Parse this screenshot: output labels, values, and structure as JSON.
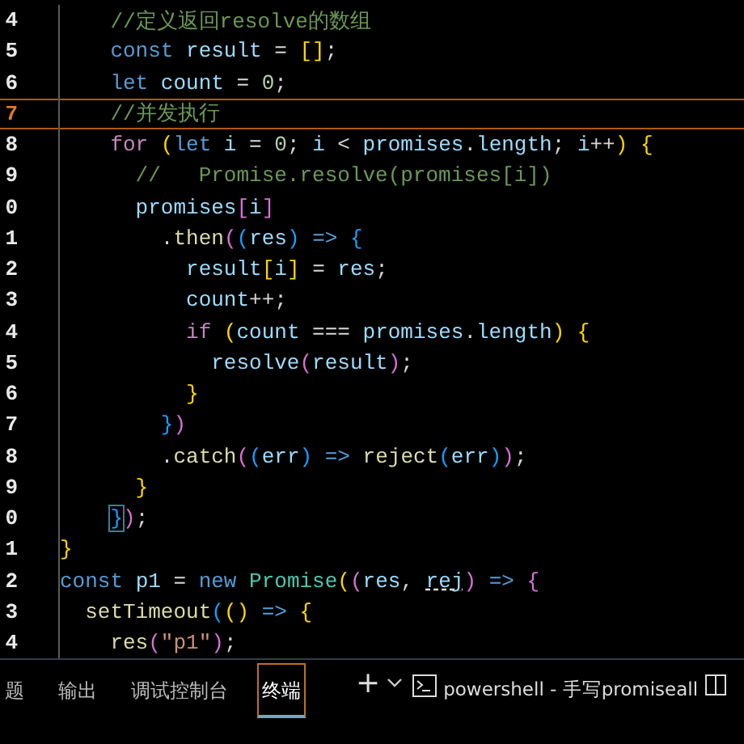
{
  "editor": {
    "lines": [
      {
        "number": "4",
        "current": false,
        "tokens": [
          {
            "t": "    //定义返回resolve的数组",
            "kind": "comment"
          }
        ]
      },
      {
        "number": "5",
        "current": false,
        "tokens": [
          {
            "t": "    const",
            "kind": "kw"
          },
          {
            "t": " result",
            "kind": "var"
          },
          {
            "t": " = ",
            "kind": "plain"
          },
          {
            "t": "[",
            "kind": "br1"
          },
          {
            "t": "]",
            "kind": "br1"
          },
          {
            "t": ";",
            "kind": "plain"
          }
        ]
      },
      {
        "number": "6",
        "current": false,
        "tokens": [
          {
            "t": "    let",
            "kind": "kw"
          },
          {
            "t": " count",
            "kind": "var"
          },
          {
            "t": " = ",
            "kind": "plain"
          },
          {
            "t": "0",
            "kind": "num"
          },
          {
            "t": ";",
            "kind": "plain"
          }
        ]
      },
      {
        "number": "7",
        "current": true,
        "tokens": [
          {
            "t": "    //并发执行",
            "kind": "comment"
          }
        ]
      },
      {
        "number": "8",
        "current": false,
        "tokens": [
          {
            "t": "    for",
            "kind": "ctrl"
          },
          {
            "t": " (",
            "kind": "br1"
          },
          {
            "t": "let",
            "kind": "kw"
          },
          {
            "t": " i",
            "kind": "var"
          },
          {
            "t": " = ",
            "kind": "plain"
          },
          {
            "t": "0",
            "kind": "num"
          },
          {
            "t": "; ",
            "kind": "plain"
          },
          {
            "t": "i",
            "kind": "var"
          },
          {
            "t": " < ",
            "kind": "plain"
          },
          {
            "t": "promises",
            "kind": "var"
          },
          {
            "t": ".",
            "kind": "plain"
          },
          {
            "t": "length",
            "kind": "var"
          },
          {
            "t": "; ",
            "kind": "plain"
          },
          {
            "t": "i",
            "kind": "var"
          },
          {
            "t": "++",
            "kind": "plain"
          },
          {
            "t": ")",
            "kind": "br1"
          },
          {
            "t": " {",
            "kind": "br1"
          }
        ]
      },
      {
        "number": "9",
        "current": false,
        "tokens": [
          {
            "t": "      //   Promise.resolve(promises[i])",
            "kind": "comment"
          }
        ]
      },
      {
        "number": "0",
        "current": false,
        "tokens": [
          {
            "t": "      promises",
            "kind": "var"
          },
          {
            "t": "[",
            "kind": "br2"
          },
          {
            "t": "i",
            "kind": "var"
          },
          {
            "t": "]",
            "kind": "br2"
          }
        ]
      },
      {
        "number": "1",
        "current": false,
        "tokens": [
          {
            "t": "        .",
            "kind": "plain"
          },
          {
            "t": "then",
            "kind": "fn"
          },
          {
            "t": "(",
            "kind": "br2"
          },
          {
            "t": "(",
            "kind": "br3"
          },
          {
            "t": "res",
            "kind": "var"
          },
          {
            "t": ")",
            "kind": "br3"
          },
          {
            "t": " =>",
            "kind": "kw"
          },
          {
            "t": " {",
            "kind": "br3"
          }
        ]
      },
      {
        "number": "2",
        "current": false,
        "tokens": [
          {
            "t": "          result",
            "kind": "var"
          },
          {
            "t": "[",
            "kind": "br1"
          },
          {
            "t": "i",
            "kind": "var"
          },
          {
            "t": "]",
            "kind": "br1"
          },
          {
            "t": " = ",
            "kind": "plain"
          },
          {
            "t": "res",
            "kind": "var"
          },
          {
            "t": ";",
            "kind": "plain"
          }
        ]
      },
      {
        "number": "3",
        "current": false,
        "tokens": [
          {
            "t": "          count",
            "kind": "var"
          },
          {
            "t": "++;",
            "kind": "plain"
          }
        ]
      },
      {
        "number": "4",
        "current": false,
        "tokens": [
          {
            "t": "          if",
            "kind": "ctrl"
          },
          {
            "t": " (",
            "kind": "br1"
          },
          {
            "t": "count",
            "kind": "var"
          },
          {
            "t": " === ",
            "kind": "plain"
          },
          {
            "t": "promises",
            "kind": "var"
          },
          {
            "t": ".",
            "kind": "plain"
          },
          {
            "t": "length",
            "kind": "var"
          },
          {
            "t": ")",
            "kind": "br1"
          },
          {
            "t": " {",
            "kind": "br1"
          }
        ]
      },
      {
        "number": "5",
        "current": false,
        "tokens": [
          {
            "t": "            resolve",
            "kind": "var"
          },
          {
            "t": "(",
            "kind": "br2"
          },
          {
            "t": "result",
            "kind": "var"
          },
          {
            "t": ")",
            "kind": "br2"
          },
          {
            "t": ";",
            "kind": "plain"
          }
        ]
      },
      {
        "number": "6",
        "current": false,
        "tokens": [
          {
            "t": "          }",
            "kind": "br1"
          }
        ]
      },
      {
        "number": "7",
        "current": false,
        "tokens": [
          {
            "t": "        }",
            "kind": "br3"
          },
          {
            "t": ")",
            "kind": "br2"
          }
        ]
      },
      {
        "number": "8",
        "current": false,
        "tokens": [
          {
            "t": "        .",
            "kind": "plain"
          },
          {
            "t": "catch",
            "kind": "fn"
          },
          {
            "t": "(",
            "kind": "br2"
          },
          {
            "t": "(",
            "kind": "br3"
          },
          {
            "t": "err",
            "kind": "var"
          },
          {
            "t": ")",
            "kind": "br3"
          },
          {
            "t": " =>",
            "kind": "kw"
          },
          {
            "t": " reject",
            "kind": "fn"
          },
          {
            "t": "(",
            "kind": "br3"
          },
          {
            "t": "err",
            "kind": "var"
          },
          {
            "t": ")",
            "kind": "br3"
          },
          {
            "t": ")",
            "kind": "br2"
          },
          {
            "t": ";",
            "kind": "plain"
          }
        ]
      },
      {
        "number": "9",
        "current": false,
        "tokens": [
          {
            "t": "      }",
            "kind": "br1"
          }
        ]
      },
      {
        "number": "0",
        "current": false,
        "tokens": [
          {
            "t": "    }",
            "kind": "match"
          },
          {
            "t": ")",
            "kind": "br2"
          },
          {
            "t": ";",
            "kind": "plain"
          }
        ]
      },
      {
        "number": "1",
        "current": false,
        "tokens": [
          {
            "t": "}",
            "kind": "br1"
          }
        ]
      },
      {
        "number": "2",
        "current": false,
        "tokens": [
          {
            "t": "const",
            "kind": "kw"
          },
          {
            "t": " p1",
            "kind": "var"
          },
          {
            "t": " = ",
            "kind": "plain"
          },
          {
            "t": "new",
            "kind": "kw"
          },
          {
            "t": " Promise",
            "kind": "cls"
          },
          {
            "t": "(",
            "kind": "br1"
          },
          {
            "t": "(",
            "kind": "br2"
          },
          {
            "t": "res",
            "kind": "var"
          },
          {
            "t": ", ",
            "kind": "plain"
          },
          {
            "t": "rej",
            "kind": "warn"
          },
          {
            "t": ")",
            "kind": "br2"
          },
          {
            "t": " =>",
            "kind": "kw"
          },
          {
            "t": " {",
            "kind": "br2"
          }
        ]
      },
      {
        "number": "3",
        "current": false,
        "tokens": [
          {
            "t": "  setTimeout",
            "kind": "fn"
          },
          {
            "t": "(",
            "kind": "br3"
          },
          {
            "t": "()",
            "kind": "br1"
          },
          {
            "t": " =>",
            "kind": "kw"
          },
          {
            "t": " {",
            "kind": "br1"
          }
        ]
      },
      {
        "number": "4",
        "current": false,
        "tokens": [
          {
            "t": "    res",
            "kind": "fn"
          },
          {
            "t": "(",
            "kind": "br2"
          },
          {
            "t": "\"p1\"",
            "kind": "str"
          },
          {
            "t": ")",
            "kind": "br2"
          },
          {
            "t": ";",
            "kind": "plain"
          }
        ]
      }
    ]
  },
  "panel": {
    "tabs": [
      {
        "label": "题",
        "selected": false
      },
      {
        "label": "输出",
        "selected": false
      },
      {
        "label": "调试控制台",
        "selected": false
      },
      {
        "label": "终端",
        "selected": true
      }
    ],
    "new_terminal": "+",
    "terminal_name": "powershell - 手写promiseall"
  }
}
